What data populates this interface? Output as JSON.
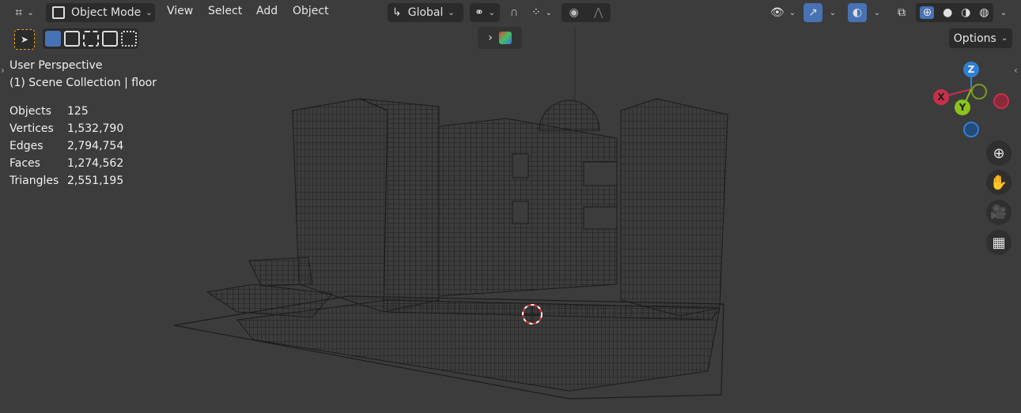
{
  "header": {
    "editor_type_icon": "axis-3d-icon",
    "mode": "Object Mode",
    "menus": [
      "View",
      "Select",
      "Add",
      "Object"
    ],
    "orientation": "Global",
    "options_label": "Options"
  },
  "overlay": {
    "perspective": "User Perspective",
    "collection": "(1) Scene Collection | floor",
    "stats": [
      {
        "label": "Objects",
        "value": "125"
      },
      {
        "label": "Vertices",
        "value": "1,532,790"
      },
      {
        "label": "Edges",
        "value": "2,794,754"
      },
      {
        "label": "Faces",
        "value": "1,274,562"
      },
      {
        "label": "Triangles",
        "value": "2,551,195"
      }
    ]
  },
  "gizmo": {
    "z": "Z",
    "x": "X",
    "y": "Y",
    "colors": {
      "x": "#c8304a",
      "y": "#8cc21b",
      "z": "#2f7fd6"
    }
  },
  "nav_buttons": [
    "zoom-icon",
    "hand-pan-icon",
    "camera-icon",
    "grid-ortho-icon"
  ],
  "colors": {
    "accent": "#4772b3",
    "background": "#3c3c3c",
    "widget": "#2b2b2b"
  }
}
